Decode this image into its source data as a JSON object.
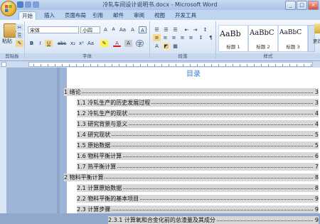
{
  "window": {
    "title": "冷轧车间设计说明书.docx - Microsoft Word"
  },
  "tabs": [
    "开始",
    "插入",
    "页面布局",
    "引用",
    "邮件",
    "审阅",
    "视图",
    "开发工具"
  ],
  "ribbon": {
    "clipboard": {
      "paste_label": "粘贴",
      "group_label": "剪贴板"
    },
    "font": {
      "name": "宋体",
      "size": "小四",
      "group_label": "字体",
      "bold": "B",
      "italic": "I",
      "underline": "U",
      "strike": "abc",
      "subscript": "x₂",
      "superscript": "x²",
      "grow": "A",
      "shrink": "A",
      "clear": "Aa",
      "phonetic": "A"
    },
    "paragraph": {
      "group_label": "段落"
    },
    "styles": {
      "group_label": "样式",
      "items": [
        {
          "sample": "AaBb",
          "name": "标题 1"
        },
        {
          "sample": "AaBbC",
          "name": "标题 2"
        },
        {
          "sample": "AaBbC",
          "name": "标题 3"
        }
      ],
      "change_label": "更改样式"
    }
  },
  "document": {
    "toc_title": "目录",
    "entries": [
      {
        "text": "1  绪论",
        "page": "3",
        "level": 1
      },
      {
        "text": "1.1  冷轧生产的历史发展过程",
        "page": "3",
        "level": 2
      },
      {
        "text": "1.2  冷轧生产的现状",
        "page": "4",
        "level": 2
      },
      {
        "text": "1.3  研究背景与意义",
        "page": "4",
        "level": 2
      },
      {
        "text": "1.4  研究现状",
        "page": "5",
        "level": 2
      },
      {
        "text": "1.5  原始数据",
        "page": "5",
        "level": 2
      },
      {
        "text": "1.6  物料平衡计算",
        "page": "6",
        "level": 2
      },
      {
        "text": "1.7  热平衡计算",
        "page": "7",
        "level": 2
      },
      {
        "text": "2  物料平衡计算",
        "page": "8",
        "level": 1
      },
      {
        "text": "2.1  计算原始数据",
        "page": "8",
        "level": 2
      },
      {
        "text": "2.2  物料平衡的基本项目",
        "page": "9",
        "level": 2
      },
      {
        "text": "2.3  计算步骤",
        "page": "9",
        "level": 2
      },
      {
        "text": "2.3.1  计算氧和合金化前的总渣量及其成分",
        "page": "9",
        "level": 3
      }
    ]
  },
  "colors": {
    "accent": "#3a7fd0",
    "ribbon_bg": "#dde8f6",
    "tab_bar": "#bfd4ef"
  }
}
